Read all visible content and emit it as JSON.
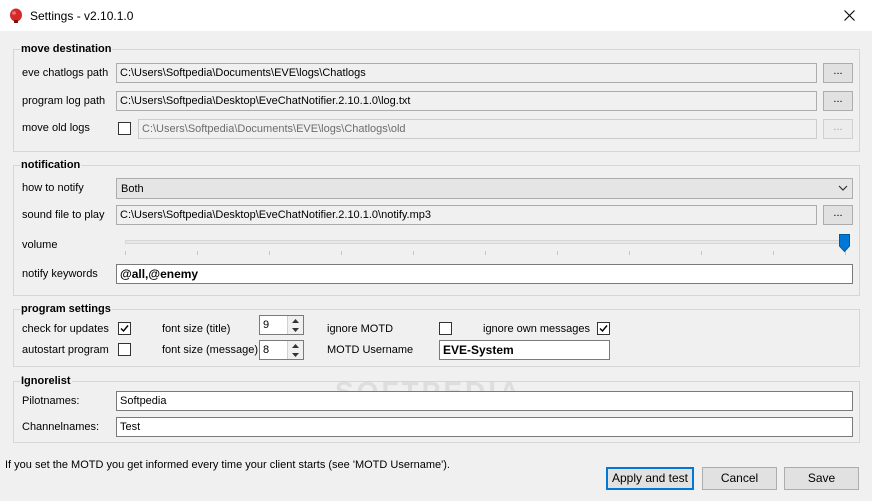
{
  "window": {
    "title": "Settings - v2.10.1.0",
    "accent_color": "#0078d7",
    "app_icon": "red-bell-icon"
  },
  "move_destination": {
    "legend": "move destination",
    "chatlogs_label": "eve chatlogs path",
    "chatlogs_value": "C:\\Users\\Softpedia\\Documents\\EVE\\logs\\Chatlogs",
    "programlog_label": "program log path",
    "programlog_value": "C:\\Users\\Softpedia\\Desktop\\EveChatNotifier.2.10.1.0\\log.txt",
    "moveold_label": "move old logs",
    "moveold_checked": false,
    "moveold_value": "C:\\Users\\Softpedia\\Documents\\EVE\\logs\\Chatlogs\\old",
    "browse_label": "..."
  },
  "notification": {
    "legend": "notification",
    "how_label": "how to notify",
    "how_value": "Both",
    "sound_label": "sound file to play",
    "sound_value": "C:\\Users\\Softpedia\\Desktop\\EveChatNotifier.2.10.1.0\\notify.mp3",
    "volume_label": "volume",
    "volume_level": 1.0,
    "keywords_label": "notify keywords",
    "keywords_value": "@all,@enemy"
  },
  "program_settings": {
    "legend": "program settings",
    "check_updates_label": "check for updates",
    "check_updates_checked": true,
    "autostart_label": "autostart program",
    "autostart_checked": false,
    "font_title_label": "font size (title)",
    "font_title_value": "9",
    "font_message_label": "font size (message)",
    "font_message_value": "8",
    "ignore_motd_label": "ignore MOTD",
    "ignore_motd_checked": false,
    "motd_username_label": "MOTD Username",
    "motd_username_value": "EVE-System",
    "ignore_own_label": "ignore own messages",
    "ignore_own_checked": true
  },
  "ignorelist": {
    "legend": "Ignorelist",
    "pilotnames_label": "Pilotnames:",
    "pilotnames_value": "Softpedia",
    "channelnames_label": "Channelnames:",
    "channelnames_value": "Test"
  },
  "footer": {
    "info_text": "If you set the MOTD you get informed every time your client starts (see 'MOTD Username').",
    "apply_label": "Apply and test",
    "cancel_label": "Cancel",
    "save_label": "Save"
  },
  "watermark": "SOFTPEDIA"
}
